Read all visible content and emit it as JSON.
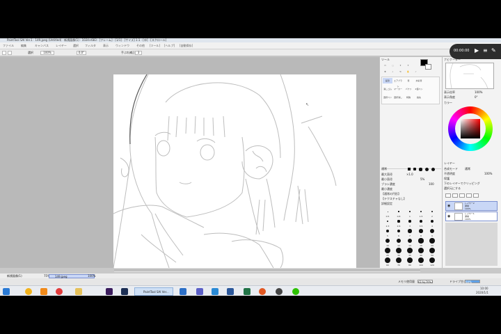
{
  "window": {
    "title": "PaintTool SAI Ver.1 · 149.jpeg (Untitled) · 新規画像(1) · 1024×683 · [フレーム] · [1/1] · [サイズ] 1:1 · [ゆ] · [スクロール]"
  },
  "menu": {
    "items": [
      "ファイル",
      "編集",
      "キャンバス",
      "レイヤー",
      "選択",
      "フィルタ",
      "表示",
      "ウィンドウ",
      "その他",
      "[ツール]",
      "[ヘルプ]",
      "[自動保存]"
    ]
  },
  "toolbar": {
    "select_label": "選択",
    "zoom": "100%",
    "angle": "0.0°",
    "stabilizer_label": "手ぶれ補正",
    "stabilizer_value": "3"
  },
  "tools": {
    "title": "ツール",
    "color_title": "カラー",
    "brush_items": [
      "鉛筆",
      "エアブラシ",
      "筆",
      "水彩筆",
      "消しゴム",
      "マーカー",
      "バケツ",
      "2値ペン",
      "選択ペン",
      "選択消し",
      "特殊",
      "指先"
    ],
    "normal_label": "通常",
    "size_label": "最大直径",
    "size_value": "×1.0",
    "min_size_label": "最小直径",
    "min_size_value": "5%",
    "density_label": "ブラシ濃度",
    "density_value": "100",
    "min_density_label": "最小濃度",
    "no_texture": "【通常の円形】",
    "no_texture2": "【テクスチャなし】",
    "advanced_label": "詳細設定",
    "dot_labels": [
      "0.5",
      "0.8",
      "1",
      "1.5",
      "2",
      "2.3",
      "2.6",
      "3",
      "3.5",
      "4",
      "5",
      "6",
      "7",
      "8",
      "9",
      "10",
      "12",
      "14",
      "16",
      "20",
      "25",
      "30",
      "35",
      "40",
      "50",
      "60",
      "70",
      "80",
      "100",
      "120"
    ]
  },
  "navigator": {
    "title": "ナビゲーター",
    "zoom_label": "表示倍率",
    "zoom_value": "100%",
    "angle_label": "表示角度",
    "angle_value": "0°"
  },
  "layers": {
    "title": "レイヤー",
    "blend_label": "合成モード",
    "blend_value": "通常",
    "opacity_label": "不透明度",
    "opacity_value": "100%",
    "protect_label": "保護",
    "clip_label": "下のレイヤーでクリッピング",
    "select_source_label": "選択元にする",
    "list": [
      {
        "name": "レイヤー2",
        "mode": "通常",
        "opacity": "100%"
      },
      {
        "name": "レイヤー1",
        "mode": "通常",
        "opacity": "100%"
      }
    ]
  },
  "docbar": {
    "tabs": [
      {
        "name": "新規画像(1)",
        "zoom": "75%"
      },
      {
        "name": "149.jpeg",
        "zoom": "100%"
      }
    ]
  },
  "status": {
    "memory_label": "メモリ使用量",
    "memory_value": "61%(70%)",
    "disk_label": "ドライブ空き",
    "disk_value": "60%"
  },
  "taskbar": {
    "active_app": "PaintTool SAI Ver...",
    "time": "10:00",
    "date": "2020/1/1"
  },
  "recorder": {
    "time": "00:00:00"
  },
  "colors": {
    "accent": "#4b6fd1",
    "selection": "#c9d7f6"
  }
}
